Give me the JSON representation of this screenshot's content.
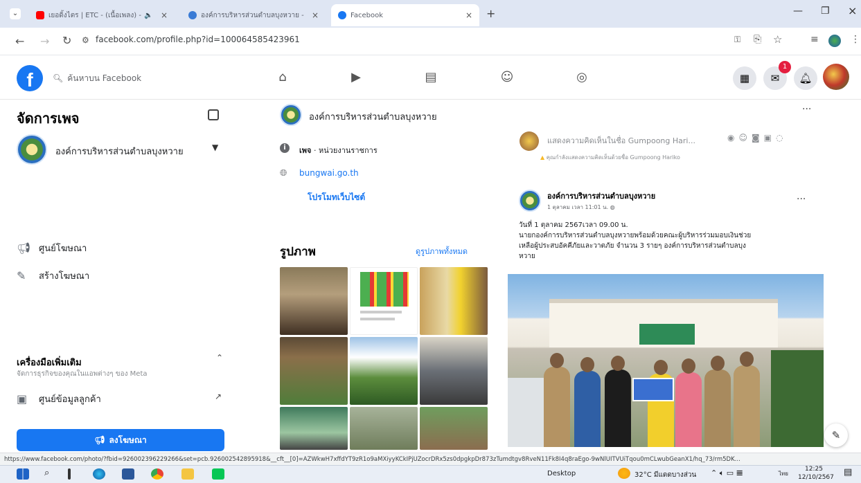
{
  "browser": {
    "tabs": [
      {
        "label": "เยอดิ้งไตร | ETC - (เนื้อเพลง) -"
      },
      {
        "label": "องค์การบริหารส่วนตำบลบุงหวาย - "
      },
      {
        "label": "Facebook"
      }
    ],
    "new_tab": "+",
    "url": "facebook.com/profile.php?id=100064585423961"
  },
  "facebook": {
    "search_placeholder": "ค้นหาบน Facebook",
    "notification_count": "1",
    "nav_icons": [
      "home-icon",
      "video-icon",
      "marketplace-icon",
      "groups-icon",
      "gaming-icon"
    ],
    "right_icons": [
      "menu-grid-icon",
      "messenger-icon",
      "bell-icon"
    ]
  },
  "sidebar": {
    "title": "จัดการเพจ",
    "page_name": "องค์การบริหารส่วนตำบลบุงหวาย",
    "items": [
      {
        "label": "ศูนย์โฆษณา",
        "icon": "megaphone-icon"
      },
      {
        "label": "สร้างโฆษณา",
        "icon": "edit-icon"
      }
    ],
    "tools_title": "เครื่องมือเพิ่มเติม",
    "tools_subtitle": "จัดการธุรกิจของคุณในแอพต่างๆ ของ Meta",
    "tools_items": [
      {
        "label": "ศูนย์ข้อมูลลูกค้า",
        "icon": "contacts-icon"
      }
    ],
    "promote_label": "ลงโฆษณา"
  },
  "intro": {
    "page_name": "องค์การบริหารส่วนตำบลบุงหวาย",
    "category_prefix": "เพจ",
    "category": "หน่วยงานราชการ",
    "website": "bungwai.go.th",
    "promote_website": "โปรโมทเว็บไซต์",
    "photos_title": "รูปภาพ",
    "see_all_photos": "ดูรูปภาพทั้งหมด"
  },
  "feed": {
    "comment_placeholder": "แสดงความคิดเห็นในชื่อ Gumpoong Hari...",
    "comment_warning": "คุณกำลังแสดงความคิดเห็นด้วยชื่อ Gumpoong Hariko",
    "post": {
      "author": "องค์การบริหารส่วนตำบลบุงหวาย",
      "time": "1 ตุลาคม เวลา 11:01 น.",
      "text_line1": "วันที่ 1 ตุลาคม 2567เวลา 09.00 น.",
      "text_line2": "นายกองค์การบริหารส่วนตำบลบุงหวายพร้อมด้วยคณะผู้บริหารร่วมมอบเงินช่วย",
      "text_line3": "เหลือผู้ประสบอัคคีภัยและวาตภัย จำนวน 3 รายๆ องค์การบริหารส่วนตำบลบุง",
      "text_line4": "หวาย"
    }
  },
  "status_url": "https://www.facebook.com/photo/?fbid=926002396229266&set=pcb.926002542895918&__cft__[0]=AZWkwH7xffdYT9zR1o9aMXiyyKCkIPjUZocrDRx5zs0dpgkpDr873zTumdtgv8RveN11Fk8I4q8raEgo-9wNlUITVUiTqou0mCLwubGeanX1/hq_73/rm5DK...",
  "taskbar": {
    "desktop": "Desktop",
    "weather": "32°C มีแดดบางส่วน",
    "lang": "ไทย",
    "time": "12:25",
    "date": "12/10/2567"
  }
}
